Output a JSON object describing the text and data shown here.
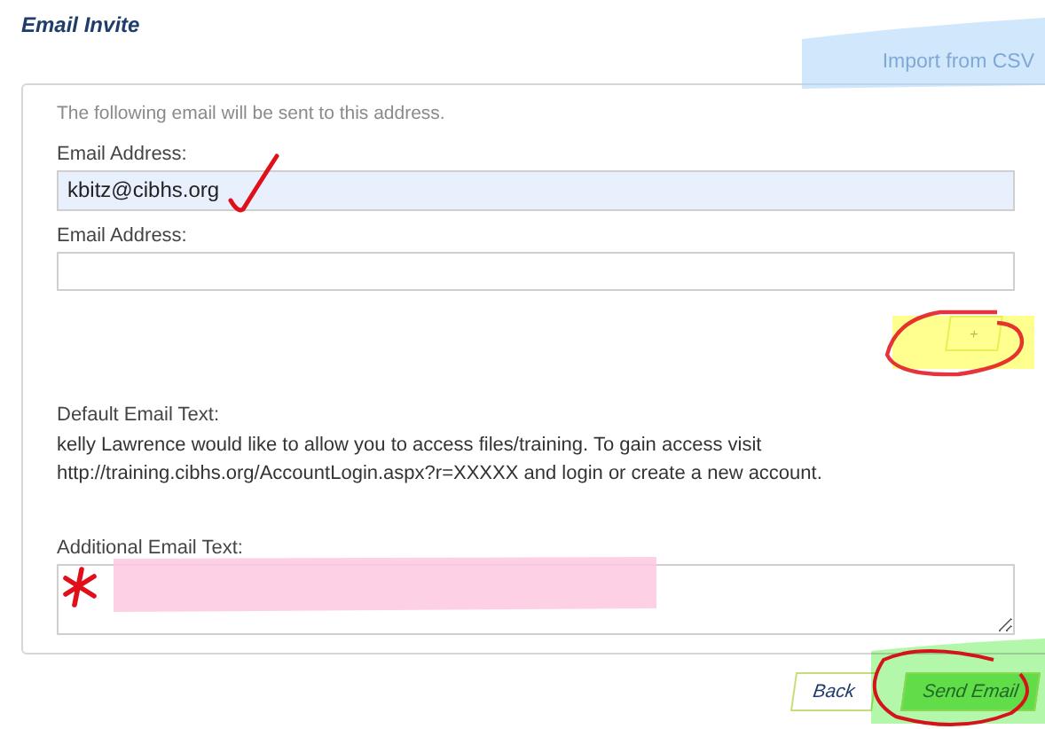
{
  "title": "Email Invite",
  "import_link": "Import from CSV",
  "panel": {
    "intro": "The following email will be sent to this address.",
    "email_fields": [
      {
        "label": "Email Address:",
        "value": "kbitz@cibhs.org",
        "filled": true
      },
      {
        "label": "Email Address:",
        "filled": false
      }
    ],
    "add_button": "+",
    "default_text": {
      "label": "Default Email Text:",
      "body": "kelly Lawrence would like to allow you to access files/training. To gain access visit http://training.cibhs.org/AccountLogin.aspx?r=XXXXX and login or create a new account."
    },
    "additional_text": {
      "label": "Additional Email Text:"
    }
  },
  "buttons": [
    {
      "label": "Back",
      "kind": "secondary"
    },
    {
      "label": "Send Email",
      "kind": "primary"
    }
  ]
}
